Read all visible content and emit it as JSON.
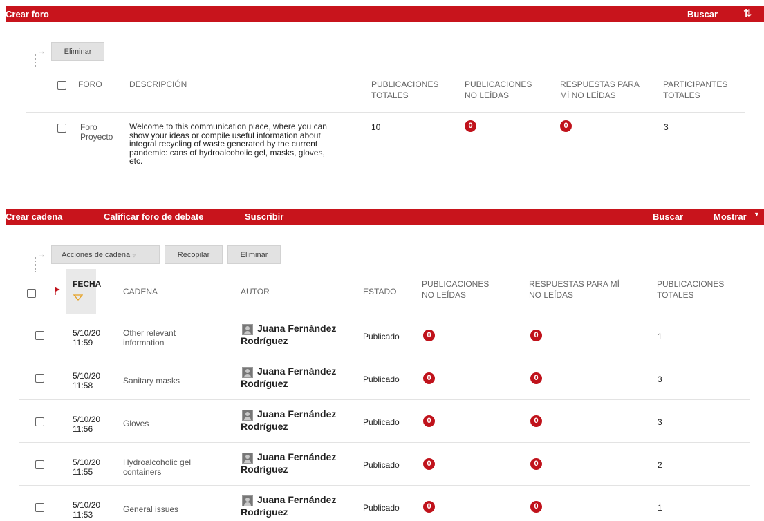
{
  "forum_bar": {
    "create": "Crear foro",
    "search": "Buscar",
    "sort_icon": "sort-icon"
  },
  "forum_actions": {
    "delete": "Eliminar"
  },
  "forum_headers": {
    "forum": "FORO",
    "description": "DESCRIPCIÓN",
    "total_posts": [
      "PUBLICACIONES",
      "TOTALES"
    ],
    "unread_posts": [
      "PUBLICACIONES",
      "NO LEÍDAS"
    ],
    "unread_replies": [
      "RESPUESTAS PARA",
      "MÍ NO LEÍDAS"
    ],
    "participants": [
      "PARTICIPANTES",
      "TOTALES"
    ]
  },
  "forum_row": {
    "name": [
      "Foro",
      "Proyecto"
    ],
    "description": [
      "Welcome to this communication place, where you can",
      "show your ideas or compile useful information about",
      "integral recycling of waste generated by the current",
      "pandemic: cans of hydroalcoholic gel, masks, gloves,",
      "etc."
    ],
    "total_posts": "10",
    "unread_posts": "0",
    "unread_replies": "0",
    "participants": "3"
  },
  "thread_bar": {
    "create": "Crear cadena",
    "grade": "Calificar foro de debate",
    "subscribe": "Suscribir",
    "search": "Buscar",
    "show": "Mostrar"
  },
  "thread_actions": {
    "thread_actions": "Acciones de cadena",
    "collect": "Recopilar",
    "delete": "Eliminar"
  },
  "thread_headers": {
    "date": "FECHA",
    "thread": "CADENA",
    "author": "AUTOR",
    "status": "ESTADO",
    "unread_posts": [
      "PUBLICACIONES",
      "NO LEÍDAS"
    ],
    "unread_replies": [
      "RESPUESTAS PARA MÍ",
      "NO LEÍDAS"
    ],
    "total_posts": [
      "PUBLICACIONES",
      "TOTALES"
    ]
  },
  "threads": [
    {
      "date": "5/10/20",
      "time": "11:59",
      "title": [
        "Other relevant",
        "information"
      ],
      "author": [
        "Juana Fernández",
        "Rodríguez"
      ],
      "status": "Publicado",
      "unread_posts": "0",
      "unread_replies": "0",
      "total": "1"
    },
    {
      "date": "5/10/20",
      "time": "11:58",
      "title": [
        "Sanitary masks",
        ""
      ],
      "author": [
        "Juana Fernández",
        "Rodríguez"
      ],
      "status": "Publicado",
      "unread_posts": "0",
      "unread_replies": "0",
      "total": "3"
    },
    {
      "date": "5/10/20",
      "time": "11:56",
      "title": [
        "Gloves",
        ""
      ],
      "author": [
        "Juana Fernández",
        "Rodríguez"
      ],
      "status": "Publicado",
      "unread_posts": "0",
      "unread_replies": "0",
      "total": "3"
    },
    {
      "date": "5/10/20",
      "time": "11:55",
      "title": [
        "Hydroalcoholic gel",
        "containers"
      ],
      "author": [
        "Juana Fernández",
        "Rodríguez"
      ],
      "status": "Publicado",
      "unread_posts": "0",
      "unread_replies": "0",
      "total": "2"
    },
    {
      "date": "5/10/20",
      "time": "11:53",
      "title": [
        "General issues",
        ""
      ],
      "author": [
        "Juana Fernández",
        "Rodríguez"
      ],
      "status": "Publicado",
      "unread_posts": "0",
      "unread_replies": "0",
      "total": "1"
    }
  ],
  "colors": {
    "accent": "#c8141c",
    "badge": "#c0121b"
  }
}
